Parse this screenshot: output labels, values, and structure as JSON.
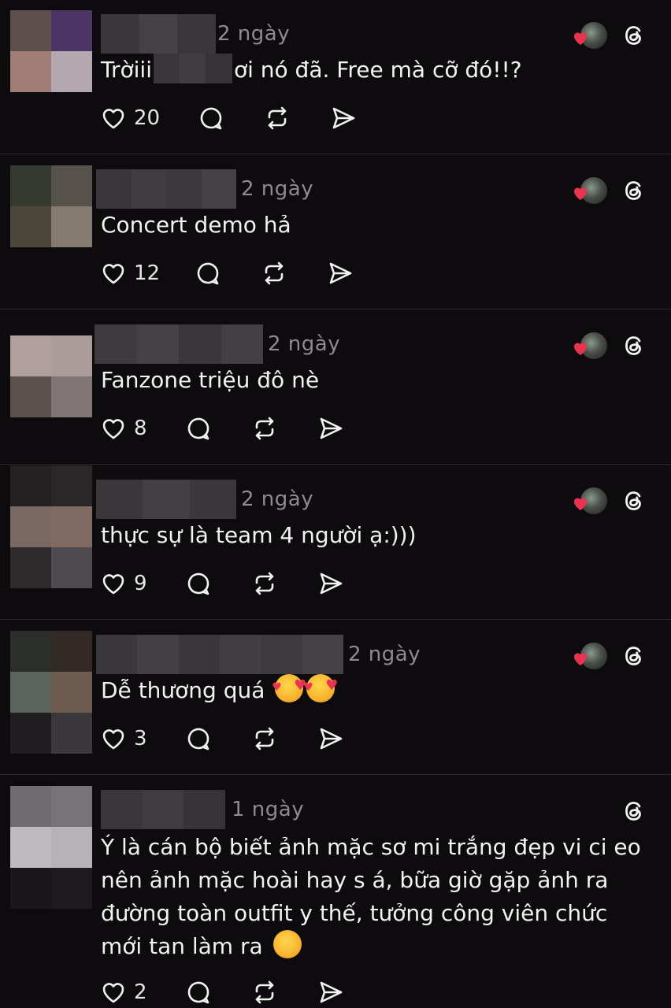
{
  "comments": [
    {
      "time": "2 ngày",
      "text_before": "Trờiii",
      "text_after": "ơi nó đã. Free mà cỡ đó!!?",
      "likes": "20",
      "show_liked_by_author": true
    },
    {
      "time": "2 ngày",
      "text": "Concert demo hả",
      "likes": "12",
      "show_liked_by_author": true
    },
    {
      "time": "2 ngày",
      "text": "Fanzone triệu đô nè",
      "likes": "8",
      "show_liked_by_author": true
    },
    {
      "time": "2 ngày",
      "text": "thực sự là team 4 người ạ:)))",
      "likes": "9",
      "show_liked_by_author": true
    },
    {
      "time": "2 ngày",
      "text": "Dễ thương quá",
      "emoji": "smiling-face-with-hearts",
      "likes": "3",
      "show_liked_by_author": true
    },
    {
      "time": "1 ngày",
      "text_lines": [
        "Ý là cán bộ biết ảnh mặc sơ mi trắng đẹp vi ci eo",
        "nên ảnh mặc hoài hay s á, bữa giờ gặp ảnh ra",
        "đường toàn outfit y thế, tưởng công viên chức",
        "mới tan làm ra"
      ],
      "emoji": "rolling-on-the-floor-laughing",
      "likes": "2",
      "show_liked_by_author": false
    }
  ],
  "colors": {
    "background": "#0e0b0e",
    "text": "#f2f2f2",
    "muted": "#8e8b8f",
    "like_red": "#e8344f",
    "divider": "#2a272b"
  },
  "icons": [
    "heart-icon",
    "comment-icon",
    "repost-icon",
    "share-icon",
    "threads-logo-icon"
  ]
}
